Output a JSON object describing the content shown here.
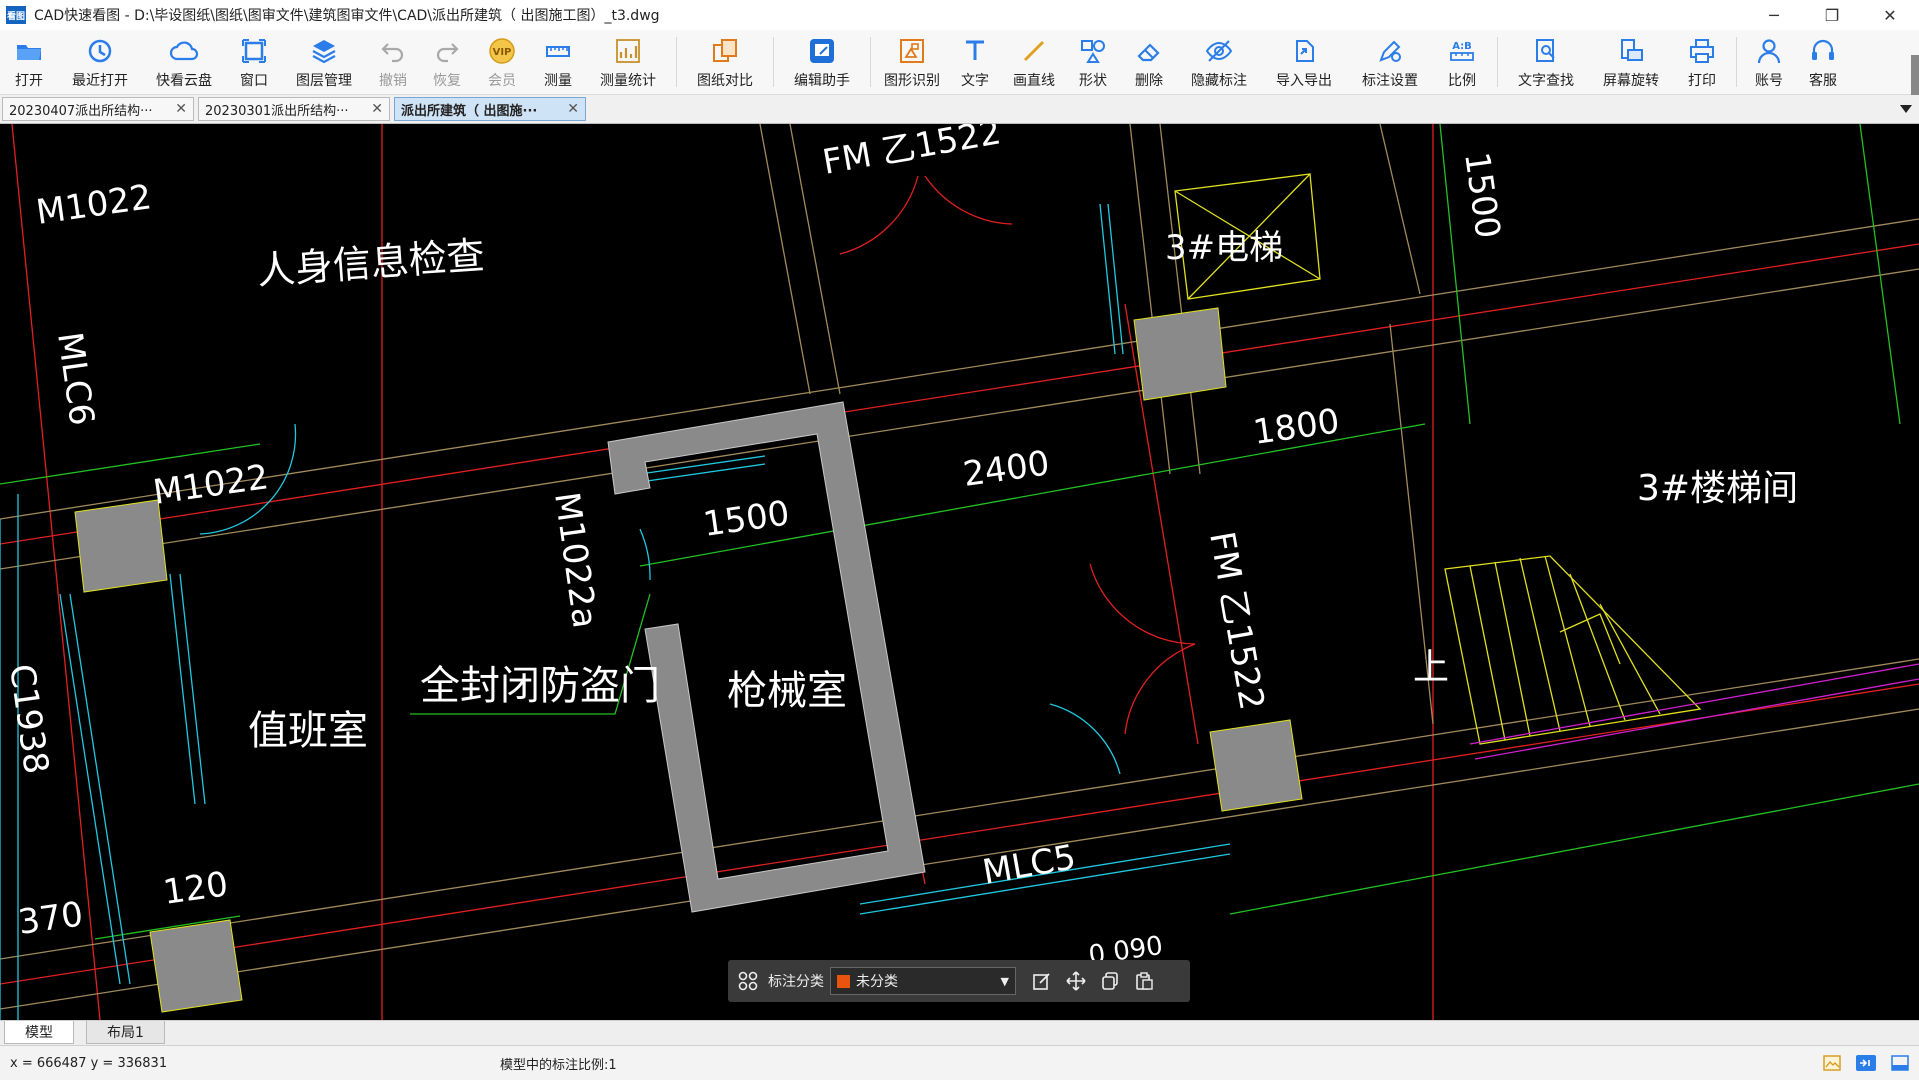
{
  "window": {
    "title": "CAD快速看图 - D:\\毕设图纸\\图纸\\图审文件\\建筑图审文件\\CAD\\派出所建筑（ 出图施工图）_t3.dwg",
    "logo_text": "看图",
    "minimize": "─",
    "maximize": "❐",
    "close": "✕"
  },
  "toolbar": {
    "open": "打开",
    "recent": "最近打开",
    "cloud": "快看云盘",
    "window": "窗口",
    "layers": "图层管理",
    "undo": "撤销",
    "redo": "恢复",
    "vip": "会员",
    "measure": "测量",
    "measure_stats": "测量统计",
    "compare": "图纸对比",
    "edit_helper": "编辑助手",
    "shape_recognize": "图形识别",
    "text": "文字",
    "line": "画直线",
    "shape": "形状",
    "delete": "删除",
    "hide_marks": "隐藏标注",
    "import_export": "导入导出",
    "mark_settings": "标注设置",
    "scale": "比例",
    "text_search": "文字查找",
    "rotate": "屏幕旋转",
    "print": "打印",
    "account": "账号",
    "service": "客服",
    "vip_badge": "VIP",
    "scale_badge": "A:B"
  },
  "tabs": [
    {
      "label": "20230407派出所结构···"
    },
    {
      "label": "20230301派出所结构···"
    },
    {
      "label": "派出所建筑（ 出图施···"
    }
  ],
  "tab_close": "✕",
  "drawing": {
    "labels": {
      "m1022_a": "M1022",
      "m1022_b": "M1022",
      "m1022a": "M1022a",
      "mlc6": "MLC6",
      "c1938": "C1938",
      "mlc5": "MLC5",
      "fm_top": "FM 乙1522",
      "fm_right": "FM 乙1522",
      "room_info": "人身信息检查",
      "room_duty": "值班室",
      "room_gun": "枪械室",
      "room_elevator": "3#电梯",
      "room_stair": "3#楼梯间",
      "door_note": "全封闭防盗门",
      "up": "上",
      "dim_1500_top": "1500",
      "dim_1500": "1500",
      "dim_2400": "2400",
      "dim_1800": "1800",
      "dim_120": "120",
      "dim_370": "370",
      "dim_partial": "0 090"
    }
  },
  "annotation_bar": {
    "label": "标注分类",
    "category": "未分类",
    "category_color": "#e8540e"
  },
  "layout_tabs": {
    "model": "模型",
    "layout1": "布局1"
  },
  "status": {
    "coords": "x = 666487 y = 336831",
    "scale_note": "模型中的标注比例:1"
  }
}
